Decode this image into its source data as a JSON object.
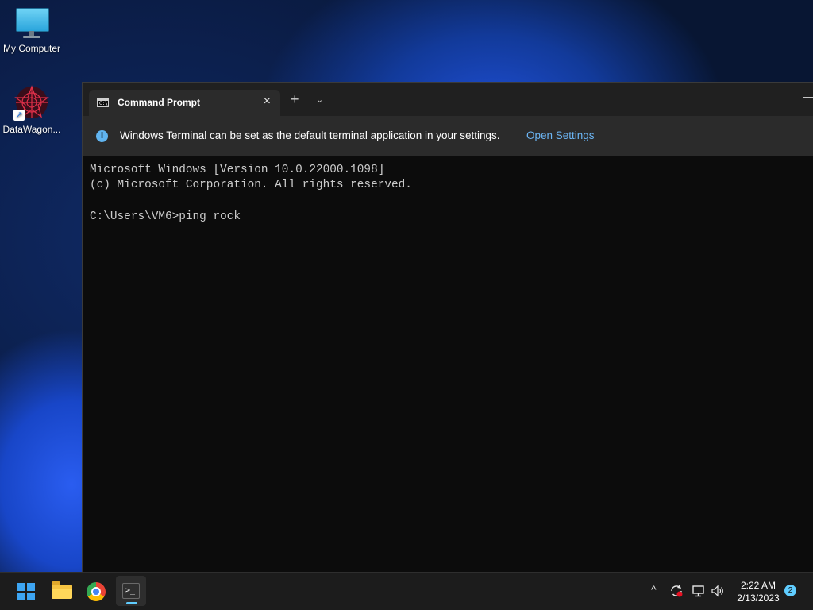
{
  "desktop": {
    "icons": [
      {
        "label": "My Computer",
        "icon": "computer-icon"
      },
      {
        "label": "DataWagon...",
        "icon": "datawagon-icon"
      }
    ]
  },
  "terminal": {
    "tab_title": "Command Prompt",
    "tab_icon_text": "C:\\_",
    "close_glyph": "×",
    "new_tab_glyph": "+",
    "dropdown_glyph": "⌄",
    "minimize_glyph": "—",
    "info_icon_glyph": "i",
    "infobar_message": "Windows Terminal can be set as the default terminal application in your settings.",
    "infobar_link": "Open Settings",
    "lines": [
      "Microsoft Windows [Version 10.0.22000.1098]",
      "(c) Microsoft Corporation. All rights reserved.",
      "",
      "C:\\Users\\VM6>ping rock"
    ]
  },
  "taskbar": {
    "apps": [
      "start-icon",
      "file-explorer-icon",
      "chrome-icon",
      "terminal-icon"
    ],
    "terminal_icon_text": ">_",
    "tray": {
      "chevron": "^",
      "time": "2:22 AM",
      "date": "2/13/2023",
      "notification_count": "2"
    }
  },
  "colors": {
    "accent": "#60cdff",
    "link": "#6cb6f5",
    "console_text": "#cccccc"
  }
}
